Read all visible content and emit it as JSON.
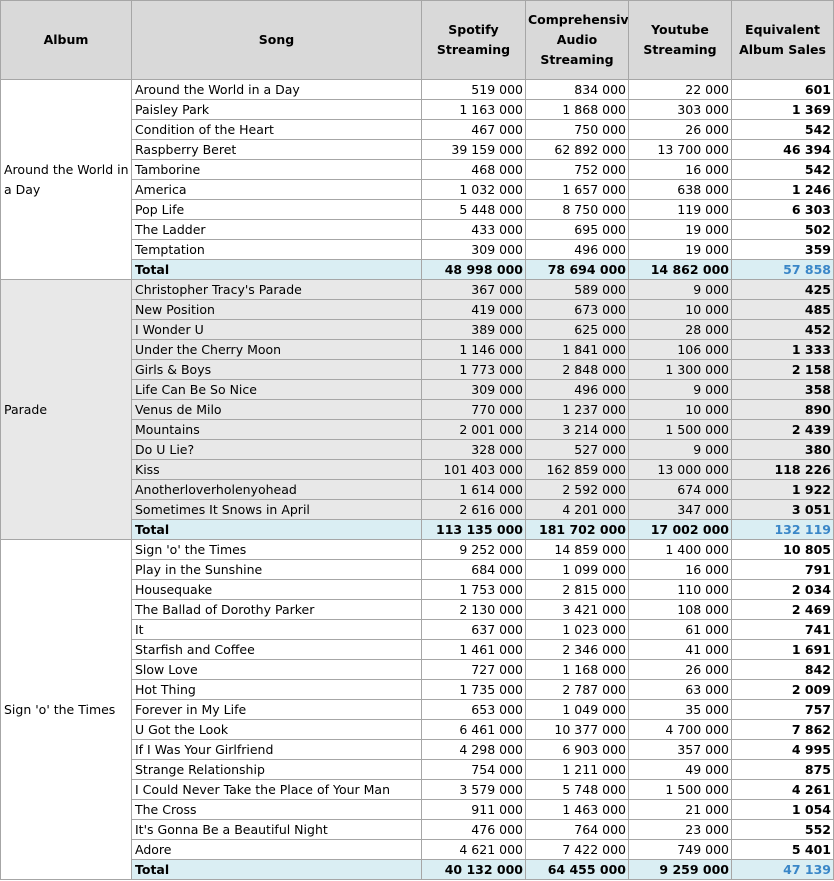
{
  "headers": {
    "album": "Album",
    "song": "Song",
    "spotify": "Spotify Streaming",
    "cas": "Comprehensive Audio Streaming",
    "youtube": "Youtube Streaming",
    "eas": "Equivalent Album Sales"
  },
  "albums": [
    {
      "name": "Around the World in a Day",
      "songs": [
        {
          "song": "Around the World in a Day",
          "spotify": "519 000",
          "cas": "834 000",
          "youtube": "22 000",
          "eas": "601"
        },
        {
          "song": "Paisley Park",
          "spotify": "1 163 000",
          "cas": "1 868 000",
          "youtube": "303 000",
          "eas": "1 369"
        },
        {
          "song": "Condition of the Heart",
          "spotify": "467 000",
          "cas": "750 000",
          "youtube": "26 000",
          "eas": "542"
        },
        {
          "song": "Raspberry Beret",
          "spotify": "39 159 000",
          "cas": "62 892 000",
          "youtube": "13 700 000",
          "eas": "46 394"
        },
        {
          "song": "Tamborine",
          "spotify": "468 000",
          "cas": "752 000",
          "youtube": "16 000",
          "eas": "542"
        },
        {
          "song": "America",
          "spotify": "1 032 000",
          "cas": "1 657 000",
          "youtube": "638 000",
          "eas": "1 246"
        },
        {
          "song": "Pop Life",
          "spotify": "5 448 000",
          "cas": "8 750 000",
          "youtube": "119 000",
          "eas": "6 303"
        },
        {
          "song": "The Ladder",
          "spotify": "433 000",
          "cas": "695 000",
          "youtube": "19 000",
          "eas": "502"
        },
        {
          "song": "Temptation",
          "spotify": "309 000",
          "cas": "496 000",
          "youtube": "19 000",
          "eas": "359"
        }
      ],
      "total": {
        "label": "Total",
        "spotify": "48 998 000",
        "cas": "78 694 000",
        "youtube": "14 862 000",
        "eas": "57 858"
      }
    },
    {
      "name": "Parade",
      "songs": [
        {
          "song": "Christopher Tracy's Parade",
          "spotify": "367 000",
          "cas": "589 000",
          "youtube": "9 000",
          "eas": "425"
        },
        {
          "song": "New Position",
          "spotify": "419 000",
          "cas": "673 000",
          "youtube": "10 000",
          "eas": "485"
        },
        {
          "song": "I Wonder U",
          "spotify": "389 000",
          "cas": "625 000",
          "youtube": "28 000",
          "eas": "452"
        },
        {
          "song": "Under the Cherry Moon",
          "spotify": "1 146 000",
          "cas": "1 841 000",
          "youtube": "106 000",
          "eas": "1 333"
        },
        {
          "song": "Girls & Boys",
          "spotify": "1 773 000",
          "cas": "2 848 000",
          "youtube": "1 300 000",
          "eas": "2 158"
        },
        {
          "song": "Life Can Be So Nice",
          "spotify": "309 000",
          "cas": "496 000",
          "youtube": "9 000",
          "eas": "358"
        },
        {
          "song": "Venus de Milo",
          "spotify": "770 000",
          "cas": "1 237 000",
          "youtube": "10 000",
          "eas": "890"
        },
        {
          "song": "Mountains",
          "spotify": "2 001 000",
          "cas": "3 214 000",
          "youtube": "1 500 000",
          "eas": "2 439"
        },
        {
          "song": "Do U Lie?",
          "spotify": "328 000",
          "cas": "527 000",
          "youtube": "9 000",
          "eas": "380"
        },
        {
          "song": "Kiss",
          "spotify": "101 403 000",
          "cas": "162 859 000",
          "youtube": "13 000 000",
          "eas": "118 226"
        },
        {
          "song": "Anotherloverholenyohead",
          "spotify": "1 614 000",
          "cas": "2 592 000",
          "youtube": "674 000",
          "eas": "1 922"
        },
        {
          "song": "Sometimes It Snows in April",
          "spotify": "2 616 000",
          "cas": "4 201 000",
          "youtube": "347 000",
          "eas": "3 051"
        }
      ],
      "total": {
        "label": "Total",
        "spotify": "113 135 000",
        "cas": "181 702 000",
        "youtube": "17 002 000",
        "eas": "132 119"
      }
    },
    {
      "name": "Sign 'o' the Times",
      "songs": [
        {
          "song": "Sign 'o' the Times",
          "spotify": "9 252 000",
          "cas": "14 859 000",
          "youtube": "1 400 000",
          "eas": "10 805"
        },
        {
          "song": "Play in the Sunshine",
          "spotify": "684 000",
          "cas": "1 099 000",
          "youtube": "16 000",
          "eas": "791"
        },
        {
          "song": "Housequake",
          "spotify": "1 753 000",
          "cas": "2 815 000",
          "youtube": "110 000",
          "eas": "2 034"
        },
        {
          "song": "The Ballad of Dorothy Parker",
          "spotify": "2 130 000",
          "cas": "3 421 000",
          "youtube": "108 000",
          "eas": "2 469"
        },
        {
          "song": "It",
          "spotify": "637 000",
          "cas": "1 023 000",
          "youtube": "61 000",
          "eas": "741"
        },
        {
          "song": "Starfish and Coffee",
          "spotify": "1 461 000",
          "cas": "2 346 000",
          "youtube": "41 000",
          "eas": "1 691"
        },
        {
          "song": "Slow Love",
          "spotify": "727 000",
          "cas": "1 168 000",
          "youtube": "26 000",
          "eas": "842"
        },
        {
          "song": "Hot Thing",
          "spotify": "1 735 000",
          "cas": "2 787 000",
          "youtube": "63 000",
          "eas": "2 009"
        },
        {
          "song": "Forever in My Life",
          "spotify": "653 000",
          "cas": "1 049 000",
          "youtube": "35 000",
          "eas": "757"
        },
        {
          "song": "U Got the Look",
          "spotify": "6 461 000",
          "cas": "10 377 000",
          "youtube": "4 700 000",
          "eas": "7 862"
        },
        {
          "song": "If I Was Your Girlfriend",
          "spotify": "4 298 000",
          "cas": "6 903 000",
          "youtube": "357 000",
          "eas": "4 995"
        },
        {
          "song": "Strange Relationship",
          "spotify": "754 000",
          "cas": "1 211 000",
          "youtube": "49 000",
          "eas": "875"
        },
        {
          "song": "I Could Never Take the Place of Your Man",
          "spotify": "3 579 000",
          "cas": "5 748 000",
          "youtube": "1 500 000",
          "eas": "4 261"
        },
        {
          "song": "The Cross",
          "spotify": "911 000",
          "cas": "1 463 000",
          "youtube": "21 000",
          "eas": "1 054"
        },
        {
          "song": "It's Gonna Be a Beautiful Night",
          "spotify": "476 000",
          "cas": "764 000",
          "youtube": "23 000",
          "eas": "552"
        },
        {
          "song": "Adore",
          "spotify": "4 621 000",
          "cas": "7 422 000",
          "youtube": "749 000",
          "eas": "5 401"
        }
      ],
      "total": {
        "label": "Total",
        "spotify": "40 132 000",
        "cas": "64 455 000",
        "youtube": "9 259 000",
        "eas": "47 139"
      }
    }
  ]
}
